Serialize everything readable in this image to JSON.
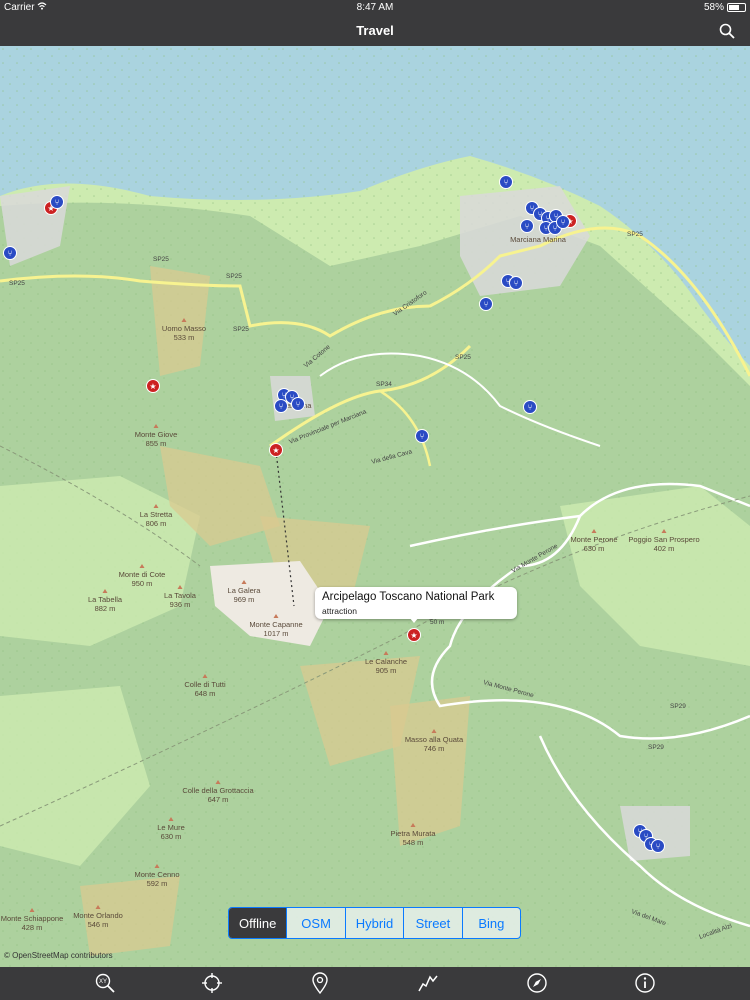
{
  "status_bar": {
    "carrier": "Carrier",
    "time": "8:47 AM",
    "battery": "58%",
    "battery_level": 0.58
  },
  "nav": {
    "title": "Travel",
    "search_icon": "search-icon"
  },
  "map": {
    "place_labels": [
      "Marciana Marina",
      "Marciana"
    ],
    "peaks": [
      {
        "name": "Uomo Masso",
        "elev": "533 m"
      },
      {
        "name": "Monte Giove",
        "elev": "855 m"
      },
      {
        "name": "La Stretta",
        "elev": "806 m"
      },
      {
        "name": "Monte di Cote",
        "elev": "950 m"
      },
      {
        "name": "La Tabella",
        "elev": "882 m"
      },
      {
        "name": "La Tavola",
        "elev": "936 m"
      },
      {
        "name": "La Galera",
        "elev": "969 m"
      },
      {
        "name": "Monte Capanne",
        "elev": "1017 m"
      },
      {
        "name": "Colle di Tutti",
        "elev": "648 m"
      },
      {
        "name": "Le Calanche",
        "elev": "905 m"
      },
      {
        "name": "Monte Perone",
        "elev": "630 m"
      },
      {
        "name": "Poggio San Prospero",
        "elev": "402 m"
      },
      {
        "name": "Masso alla Quata",
        "elev": "746 m"
      },
      {
        "name": "Colle della Grottaccia",
        "elev": "647 m"
      },
      {
        "name": "Le Mure",
        "elev": "630 m"
      },
      {
        "name": "Pietra Murata",
        "elev": "548 m"
      },
      {
        "name": "Monte Cenno",
        "elev": "592 m"
      },
      {
        "name": "Monte Orlando",
        "elev": "546 m"
      },
      {
        "name": "Monte Schiappone",
        "elev": "428 m"
      }
    ],
    "road_labels": [
      "SP25",
      "SP25",
      "SP25",
      "SP25",
      "SP25",
      "SP34",
      "SP29",
      "SP29",
      "SP25",
      "Via Cotone",
      "Via Provinciale per Marciana",
      "Via della Cava",
      "Via Monte Perone",
      "Via Monte Perone",
      "Via del Mare",
      "Località Alzi",
      "Via Cristoforo"
    ],
    "callout": {
      "title": "Arcipelago Toscano National Park",
      "subtitle": "attraction",
      "small_label": "50 m"
    }
  },
  "layers": {
    "options": [
      "Offline",
      "OSM",
      "Hybrid",
      "Street",
      "Bing"
    ],
    "selected": "Offline"
  },
  "attribution": "© OpenStreetMap contributors",
  "toolbar": {
    "icons": [
      "xy-search-icon",
      "locate-crosshair-icon",
      "map-pin-icon",
      "route-icon",
      "compass-icon",
      "info-icon"
    ]
  },
  "colors": {
    "bars": "#3a3a3c",
    "sea": "#aad3df",
    "forest": "#add19e",
    "meadow": "#cdebb0",
    "accent": "#0a7aff",
    "poi_red": "#cc2222"
  }
}
